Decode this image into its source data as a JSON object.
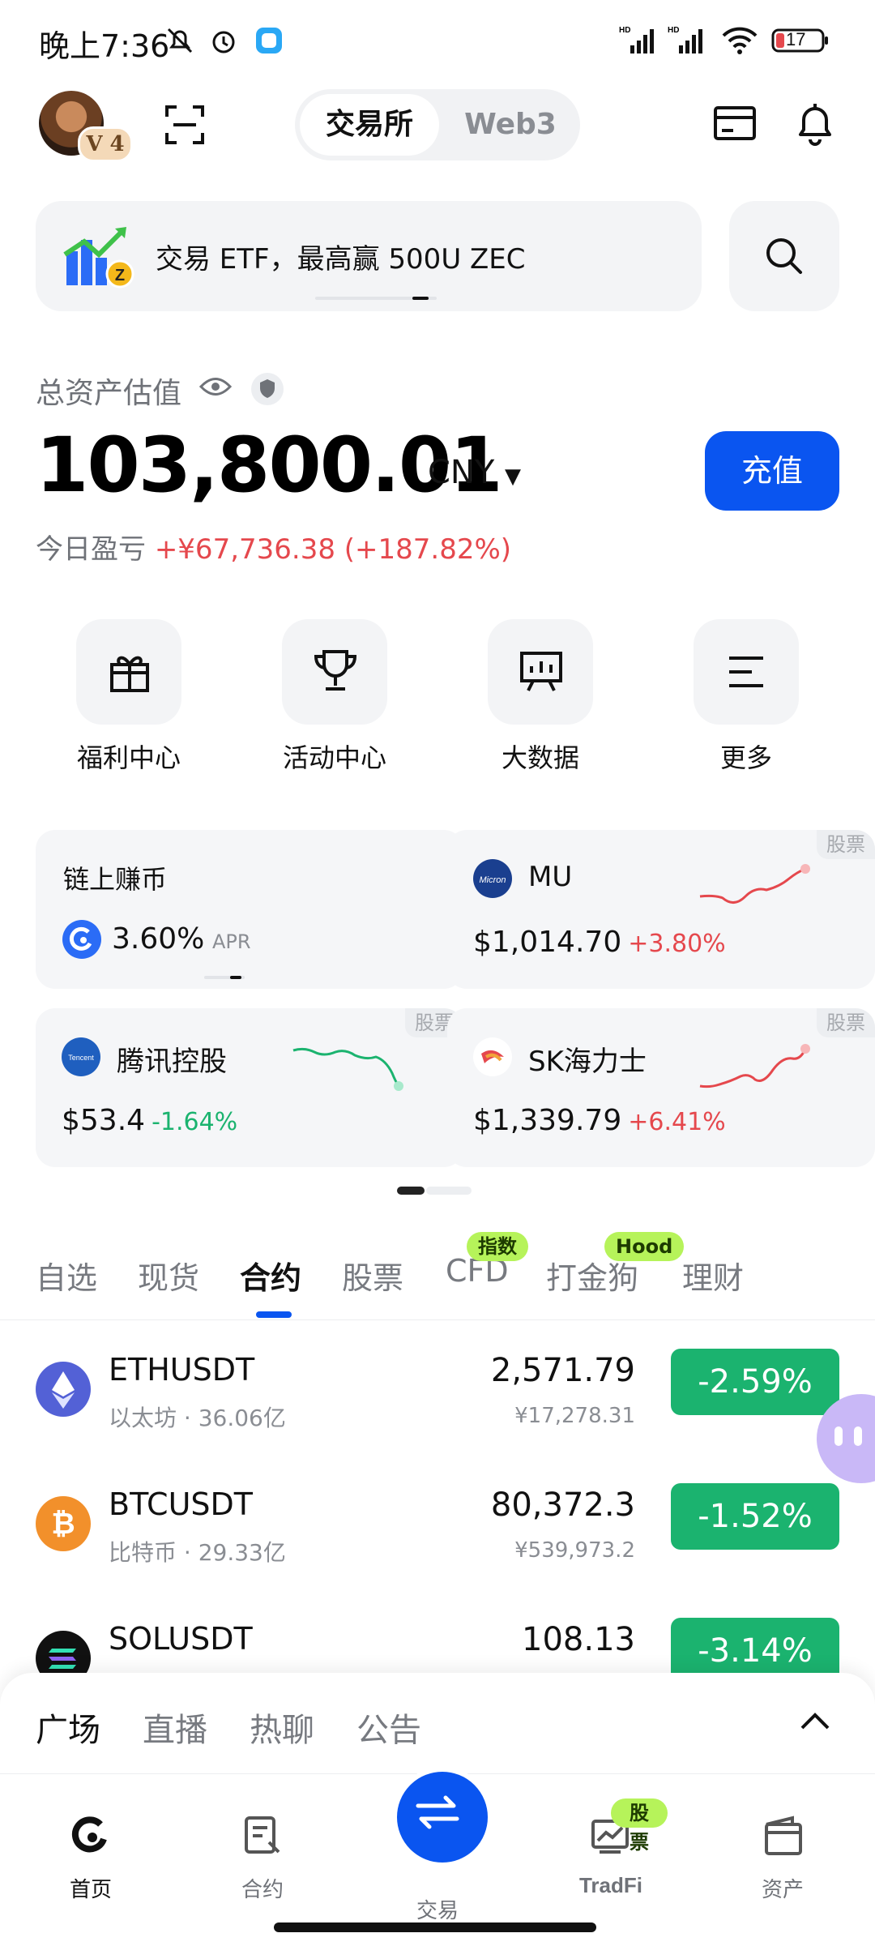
{
  "status_bar": {
    "time": "晚上7:36",
    "battery": "17",
    "network_labels": [
      "HD",
      "HD"
    ]
  },
  "header": {
    "level_badge": "V 4",
    "segments": [
      "交易所",
      "Web3"
    ],
    "active_segment": "交易所"
  },
  "banner": {
    "text": "交易 ETF，最高赢 500U ZEC"
  },
  "assets": {
    "label": "总资产估值",
    "value": "103,800.01",
    "currency": "CNY",
    "recharge_label": "充值",
    "pnl_label": "今日盈亏",
    "pnl_value": "+¥67,736.38 (+187.82%)"
  },
  "quick_actions": [
    {
      "label": "福利中心",
      "icon": "gift-icon"
    },
    {
      "label": "活动中心",
      "icon": "trophy-icon"
    },
    {
      "label": "大数据",
      "icon": "chart-board-icon"
    },
    {
      "label": "更多",
      "icon": "menu-icon"
    }
  ],
  "cards": [
    {
      "name": "链上赚币",
      "value": "3.60%",
      "suffix": "APR"
    },
    {
      "name": "MU",
      "tag": "股票",
      "price": "$1,014.70",
      "change": "+3.80%"
    },
    {
      "name": "腾讯控股",
      "tag": "股票",
      "price": "$53.4",
      "change": "-1.64%"
    },
    {
      "name": "SK海力士",
      "tag": "股票",
      "price": "$1,339.79",
      "change": "+6.41%"
    }
  ],
  "market_tabs": {
    "items": [
      "自选",
      "现货",
      "合约",
      "股票",
      "CFD",
      "打金狗",
      "理财"
    ],
    "active": "合约",
    "pills": {
      "CFD": "指数",
      "打金狗": "Hood"
    }
  },
  "market_rows": [
    {
      "symbol": "ETHUSDT",
      "sub": "以太坊 · 36.06亿",
      "price": "2,571.79",
      "fiat": "¥17,278.31",
      "change": "-2.59%"
    },
    {
      "symbol": "BTCUSDT",
      "sub": "比特币 · 29.33亿",
      "price": "80,372.3",
      "fiat": "¥539,973.2",
      "change": "-1.52%"
    },
    {
      "symbol": "SOLUSDT",
      "sub": "",
      "price": "108.13",
      "fiat": "",
      "change": "-3.14%"
    }
  ],
  "sheet_tabs": [
    "广场",
    "直播",
    "热聊",
    "公告"
  ],
  "bottom_nav": {
    "items": [
      "首页",
      "合约",
      "交易",
      "TradFi",
      "资产"
    ],
    "tradfi_badge": "股票"
  },
  "colors": {
    "accent": "#0a55f0",
    "up": "#e5484d",
    "down": "#1bb36f",
    "pill": "#b6f35a"
  }
}
